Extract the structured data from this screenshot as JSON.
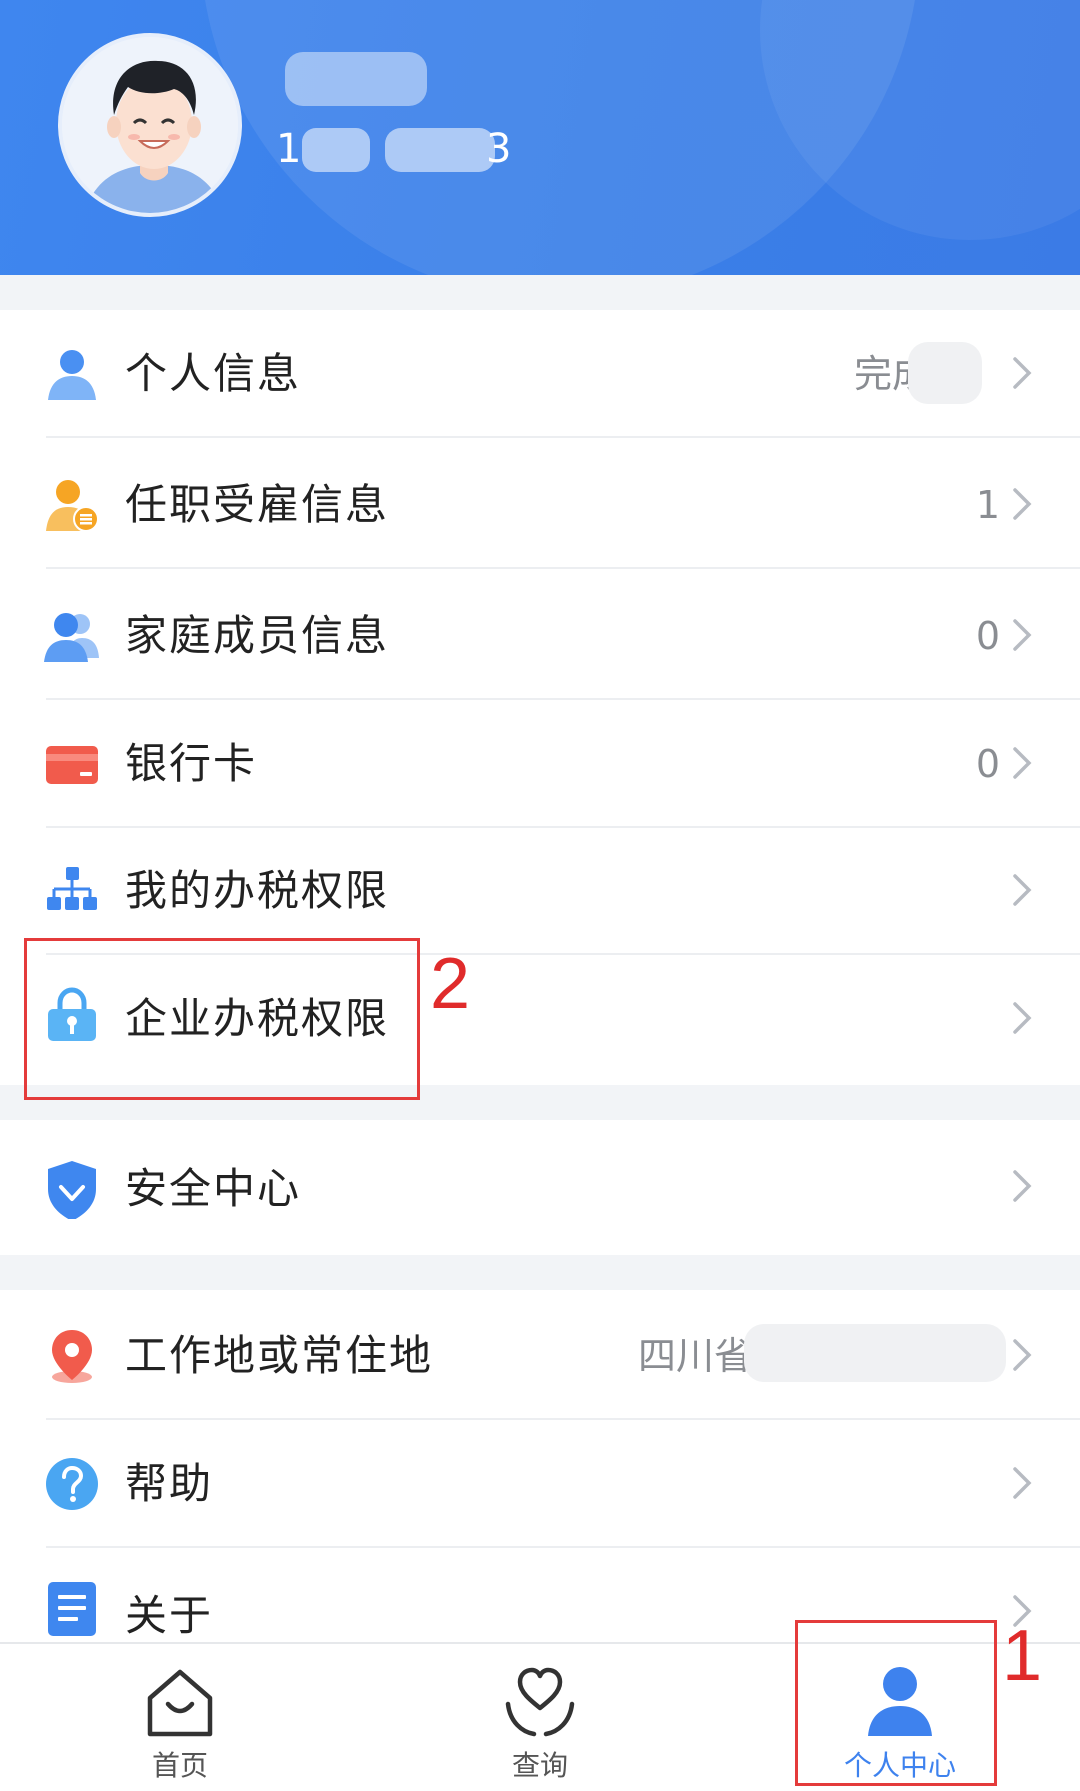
{
  "header": {
    "user_name": "",
    "phone": "1",
    "phone_tail": "3"
  },
  "menu": {
    "personal_info": {
      "label": "个人信息",
      "value": "完成"
    },
    "employment_info": {
      "label": "任职受雇信息",
      "value": "1"
    },
    "family_info": {
      "label": "家庭成员信息",
      "value": "0"
    },
    "bank_card": {
      "label": "银行卡",
      "value": "0"
    },
    "my_tax_permission": {
      "label": "我的办税权限"
    },
    "enterprise_tax_permission": {
      "label": "企业办税权限"
    },
    "security_center": {
      "label": "安全中心"
    },
    "work_location": {
      "label": "工作地或常住地",
      "value": "四川省"
    },
    "help": {
      "label": "帮助"
    },
    "about": {
      "label": "关于"
    }
  },
  "bottom_nav": {
    "home": "首页",
    "query": "查询",
    "personal_center": "个人中心"
  },
  "annotations": {
    "one": "1",
    "two": "2"
  },
  "colors": {
    "header_blue": "#3f86ef",
    "accent_blue": "#3e82ee",
    "annotation_red": "#e43b3b"
  }
}
